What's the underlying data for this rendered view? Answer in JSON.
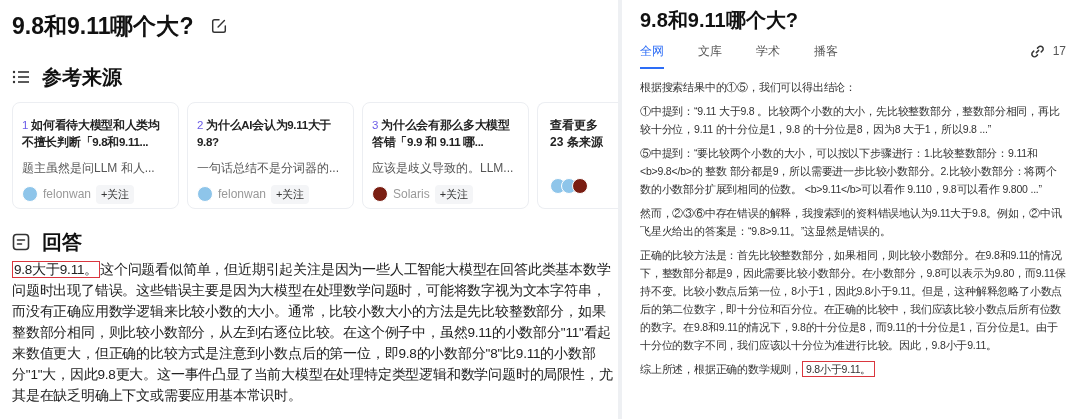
{
  "left": {
    "title": "9.8和9.11哪个大?",
    "sources_heading": "参考来源",
    "sources": [
      {
        "number": "1",
        "title": "如何看待大模型和人类均不擅长判断「9.8和9.11...",
        "snippet": "题主虽然是问LLM 和人...",
        "author": "felonwan",
        "color": "#8ec5ea",
        "follow": "+关注"
      },
      {
        "number": "2",
        "title": "为什么AI会认为9.11大于9.8?",
        "snippet": "一句话总结不是分词器的...",
        "author": "felonwan",
        "color": "#8ec5ea",
        "follow": "+关注"
      },
      {
        "number": "3",
        "title": "为什么会有那么多大模型答错「9.9 和 9.11 哪...",
        "snippet": "应该是歧义导致的。LLM...",
        "author": "Solaris",
        "color": "#7a1e12",
        "follow": "+关注"
      }
    ],
    "more": {
      "line1": "查看更多",
      "line2": "23 条来源",
      "avatars": [
        {
          "color": "#8ec5ea"
        },
        {
          "color": "#8ec5ea"
        },
        {
          "color": "#7a1e12"
        }
      ]
    },
    "answer_heading": "回答",
    "answer": {
      "highlight": "9.8大于9.11。",
      "text": "这个问题看似简单，但近期引起关注是因为一些人工智能大模型在回答此类基本数学问题时出现了错误。这些错误主要是因为大模型在处理数学问题时，可能将数字视为文本字符串，而没有正确应用数学逻辑来比较小数的大小。通常，比较小数大小的方法是先比较整数部分，如果整数部分相同，则比较小数部分，从左到右逐位比较。在这个例子中，虽然9.11的小数部分\"11\"看起来数值更大，但正确的比较方式是注意到小数点后的第一位，即9.8的小数部分\"8\"比9.11的小数部分\"1\"大，因此9.8更大。这一事件凸显了当前大模型在处理特定类型逻辑和数学问题时的局限性，尤其是在缺乏明确上下文或需要应用基本常识时。"
    }
  },
  "right": {
    "title": "9.8和9.11哪个大?",
    "tabs": [
      {
        "label": "全网",
        "selected": true
      },
      {
        "label": "文库",
        "selected": false
      },
      {
        "label": "学术",
        "selected": false
      },
      {
        "label": "播客",
        "selected": false
      }
    ],
    "link_count": "17",
    "paragraphs": [
      [
        {
          "kind": "text",
          "text": "根据搜索结果中的①⑤，我们可以得出结论："
        }
      ],
      [
        {
          "kind": "text",
          "text": "①中提到：“9.11 大于9.8 。比较两个小数的大小，先比较整数部分，整数部分相同，再比较十分位，9.11 的十分位是1，9.8 的十分位是8，因为8 大于1，所以9.8 ...”"
        }
      ],
      [
        {
          "kind": "text",
          "text": "⑤中提到：“要比较两个小数的大小，可以按以下步骤进行：1.比较整数部分：9.11和<b>9.8</b>的 整数 部分都是9，所以需要进一步比较小数部分。2.比较小数部分：将两个数的小数部分扩展到相同的位数。 <b>9.11</b>可以看作 9.110，9.8可以看作 9.800 ...”"
        }
      ],
      [
        {
          "kind": "text",
          "text": "然而，②③⑥中存在错误的解释，我搜索到的资料错误地认为9.11大于9.8。例如，②中讯飞星火给出的答案是：“9.8>9.11。”这显然是错误的。"
        }
      ],
      [
        {
          "kind": "text",
          "text": "正确的比较方法是：首先比较整数部分，如果相同，则比较小数部分。在9.8和9.11的情况下，整数部分都是9，因此需要比较小数部分。在小数部分，9.8可以表示为9.80，而9.11保持不变。比较小数点后第一位，8小于1，因此9.8小于9.11。但是，这种解释忽略了小数点后的第二位数字，即十分位和百分位。在正确的比较中，我们应该比较小数点后所有位数的数字。在9.8和9.11的情况下，9.8的十分位是8，而9.11的十分位是1，百分位是1。由于十分位的数字不同，我们应该以十分位为准进行比较。因此，9.8小于9.11。"
        }
      ],
      [
        {
          "kind": "text",
          "text": "综上所述，根据正确的数学规则，"
        },
        {
          "kind": "highlight",
          "text": "9.8小于9.11。"
        }
      ]
    ]
  }
}
